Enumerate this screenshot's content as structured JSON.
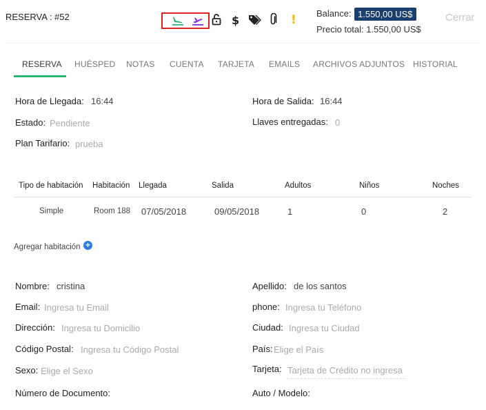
{
  "header": {
    "title": "RESERVA : #52",
    "balance_label": "Balance:",
    "balance_value": "1.550,00 US$",
    "total_label": "Precio total: 1.550,00 US$",
    "close_label": "Cerrar",
    "icons": [
      "plane-arrival-icon",
      "plane-departure-icon",
      "lock-open-icon",
      "dollar-icon",
      "tags-icon",
      "paperclip-icon",
      "warning-icon"
    ],
    "colors": {
      "arrival": "#2bb673",
      "departure": "#8a2be2",
      "warning": "#f5b800",
      "badge": "#1b3f6e",
      "highlight_box": "#e02020"
    }
  },
  "tabs": [
    {
      "label": "RESERVA",
      "active": true
    },
    {
      "label": "HUÉSPED"
    },
    {
      "label": "NOTAS"
    },
    {
      "label": "CUENTA"
    },
    {
      "label": "TARJETA"
    },
    {
      "label": "EMAILS"
    },
    {
      "label": "ARCHIVOS ADJUNTOS"
    },
    {
      "label": "HISTORIAL"
    }
  ],
  "reservation": {
    "arrival_time_label": "Hora de Llegada:",
    "arrival_time": "16:44",
    "departure_time_label": "Hora de Salida:",
    "departure_time": "16:44",
    "status_label": "Estado:",
    "status": "Pendiente",
    "keys_label": "Llaves entregadas:",
    "keys": "0",
    "rate_plan_label": "Plan Tarifario:",
    "rate_plan": "prueba"
  },
  "rooms_table": {
    "headers": [
      "Tipo de habitación",
      "Habitación",
      "Llegada",
      "Salida",
      "Adultos",
      "Niños",
      "Noches"
    ],
    "rows": [
      [
        "Simple",
        "Room 188",
        "07/05/2018",
        "09/05/2018",
        "1",
        "0",
        "2"
      ]
    ],
    "add_room_label": "Agregar habitación"
  },
  "guest": {
    "name_label": "Nombre:",
    "name": "cristina",
    "surname_label": "Apellido:",
    "surname": "de los santos",
    "email_label": "Email:",
    "email_placeholder": "Ingresa tu Email",
    "phone_label": "phone:",
    "phone_placeholder": "Ingresa tu Teléfono",
    "address_label": "Dirección:",
    "address_placeholder": "Ingresa tu Domicilio",
    "city_label": "Ciudad:",
    "city_placeholder": "Ingresa tu Ciudad",
    "postal_label": "Código Postal:",
    "postal_placeholder": "Ingresa tu Código Postal",
    "country_label": "País:",
    "country_placeholder": "Elige el País",
    "sex_label": "Sexo:",
    "sex_placeholder": "Elige el Sexo",
    "card_label": "Tarjeta:",
    "card_placeholder": "Tarjeta de Crédito no ingresa",
    "document_label": "Número de Documento:",
    "car_label": "Auto / Modelo:"
  }
}
